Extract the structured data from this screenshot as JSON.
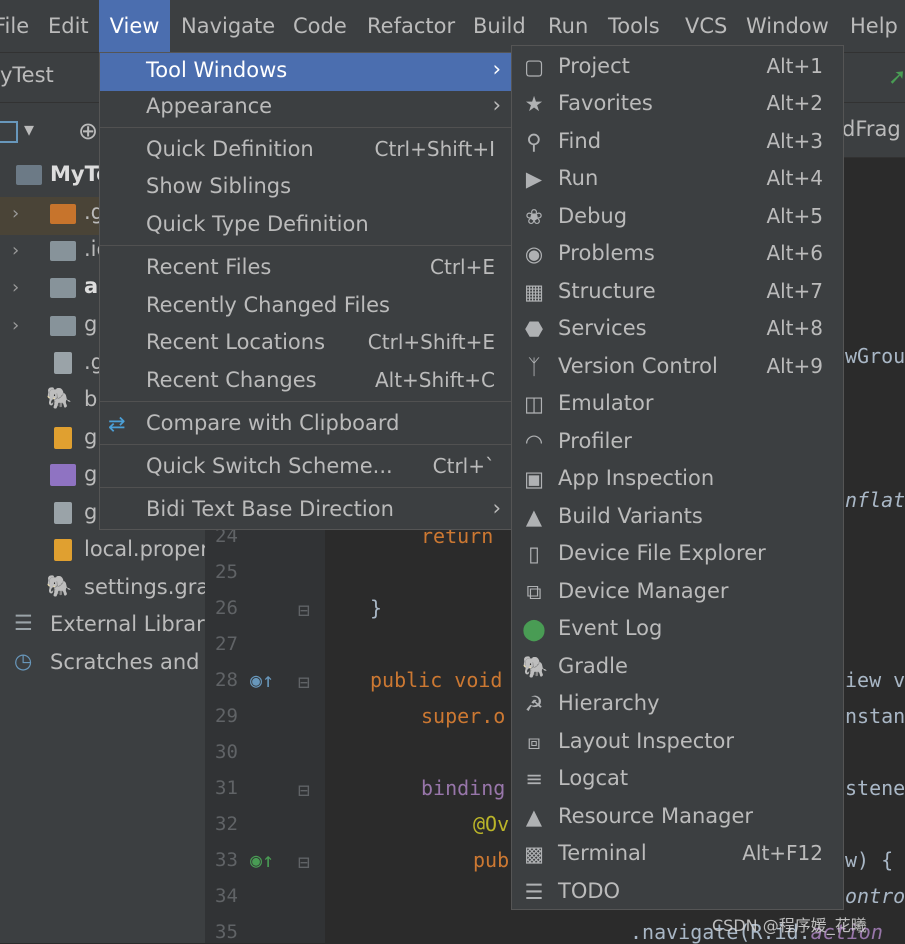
{
  "menubar": {
    "items": [
      "File",
      "Edit",
      "View",
      "Navigate",
      "Code",
      "Refactor",
      "Build",
      "Run",
      "Tools",
      "VCS",
      "Window",
      "Help"
    ],
    "active": "View"
  },
  "title": {
    "project": "yTest"
  },
  "toolbar": {
    "tab_partial": "dFrag"
  },
  "project_tree": [
    {
      "label": "MyTe",
      "bold": true
    },
    {
      "label": ".g"
    },
    {
      "label": ".id"
    },
    {
      "label": "ap",
      "bold": true
    },
    {
      "label": "gr"
    },
    {
      "label": ".g"
    },
    {
      "label": "bu"
    },
    {
      "label": "gr"
    },
    {
      "label": "gr"
    },
    {
      "label": "gr"
    },
    {
      "label": "local.proper"
    },
    {
      "label": "settings.grac"
    },
    {
      "label": "External Librarie"
    },
    {
      "label": "Scratches and C"
    }
  ],
  "editor": {
    "line_numbers": [
      "24",
      "25",
      "26",
      "27",
      "28",
      "29",
      "30",
      "31",
      "32",
      "33",
      "34",
      "35"
    ],
    "lines": {
      "return": "return",
      "brace": "}",
      "public_void": "public void",
      "super_o": "super.o",
      "binding": "binding",
      "override": "@Ov",
      "pub": "pub",
      "navigate": ".navigate(R.id.",
      "navigate_end": "action",
      "right_1": "wGroup",
      "right_2": "nflate",
      "right_3": "iew vi",
      "right_4": "nstanc",
      "right_5": "stener",
      "right_6": "w) {",
      "right_7": "ontrol"
    }
  },
  "view_menu": [
    {
      "label": "Tool Windows",
      "shortcut": "",
      "submenu": true,
      "highlighted": true
    },
    {
      "label": "Appearance",
      "shortcut": "",
      "submenu": true
    },
    {
      "label": "Quick Definition",
      "shortcut": "Ctrl+Shift+I"
    },
    {
      "label": "Show Siblings",
      "shortcut": ""
    },
    {
      "label": "Quick Type Definition",
      "shortcut": ""
    },
    {
      "label": "Recent Files",
      "shortcut": "Ctrl+E"
    },
    {
      "label": "Recently Changed Files",
      "shortcut": ""
    },
    {
      "label": "Recent Locations",
      "shortcut": "Ctrl+Shift+E"
    },
    {
      "label": "Recent Changes",
      "shortcut": "Alt+Shift+C"
    },
    {
      "label": "Compare with Clipboard",
      "shortcut": ""
    },
    {
      "label": "Quick Switch Scheme...",
      "shortcut": "Ctrl+`"
    },
    {
      "label": "Bidi Text Base Direction",
      "shortcut": "",
      "submenu": true
    }
  ],
  "tool_windows": [
    {
      "label": "Project",
      "shortcut": "Alt+1",
      "icon": "folder-icon"
    },
    {
      "label": "Favorites",
      "shortcut": "Alt+2",
      "icon": "star-icon"
    },
    {
      "label": "Find",
      "shortcut": "Alt+3",
      "icon": "search-icon"
    },
    {
      "label": "Run",
      "shortcut": "Alt+4",
      "icon": "play-icon"
    },
    {
      "label": "Debug",
      "shortcut": "Alt+5",
      "icon": "bug-icon"
    },
    {
      "label": "Problems",
      "shortcut": "Alt+6",
      "icon": "warning-icon"
    },
    {
      "label": "Structure",
      "shortcut": "Alt+7",
      "icon": "structure-icon"
    },
    {
      "label": "Services",
      "shortcut": "Alt+8",
      "icon": "services-icon"
    },
    {
      "label": "Version Control",
      "shortcut": "Alt+9",
      "icon": "vcs-branch-icon"
    },
    {
      "label": "Emulator",
      "shortcut": "",
      "icon": "emulator-icon"
    },
    {
      "label": "Profiler",
      "shortcut": "",
      "icon": "gauge-icon"
    },
    {
      "label": "App Inspection",
      "shortcut": "",
      "icon": "inspection-icon"
    },
    {
      "label": "Build Variants",
      "shortcut": "",
      "icon": "android-icon"
    },
    {
      "label": "Device File Explorer",
      "shortcut": "",
      "icon": "phone-icon"
    },
    {
      "label": "Device Manager",
      "shortcut": "",
      "icon": "device-manager-icon"
    },
    {
      "label": "Event Log",
      "shortcut": "",
      "icon": "event-log-icon"
    },
    {
      "label": "Gradle",
      "shortcut": "",
      "icon": "elephant-icon"
    },
    {
      "label": "Hierarchy",
      "shortcut": "",
      "icon": "hierarchy-icon"
    },
    {
      "label": "Layout Inspector",
      "shortcut": "",
      "icon": "layout-inspector-icon"
    },
    {
      "label": "Logcat",
      "shortcut": "",
      "icon": "logcat-icon"
    },
    {
      "label": "Resource Manager",
      "shortcut": "",
      "icon": "shapes-icon"
    },
    {
      "label": "Terminal",
      "shortcut": "Alt+F12",
      "icon": "terminal-icon"
    },
    {
      "label": "TODO",
      "shortcut": "",
      "icon": "list-icon"
    }
  ],
  "colors": {
    "accent": "#4b6eaf",
    "menu_bg": "#3c3f41",
    "editor_bg": "#2b2b2b"
  },
  "watermark": "CSDN @程序媛_花曦"
}
